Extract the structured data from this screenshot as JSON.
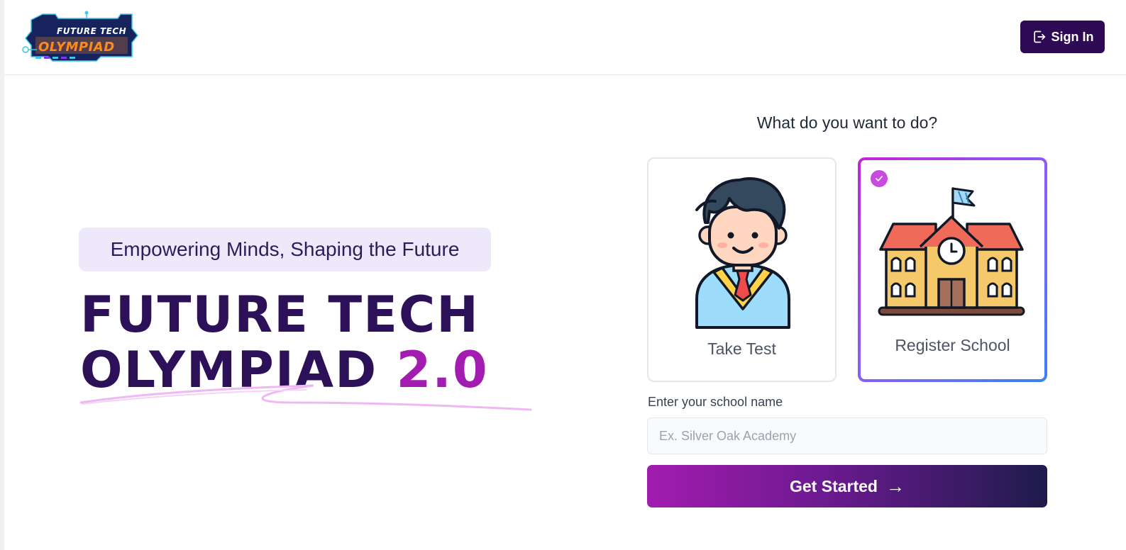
{
  "header": {
    "logo": {
      "line1": "FUTURE TECH",
      "line2": "OLYMPIAD"
    },
    "signin_label": "Sign In",
    "signin_icon": "sign-in-icon"
  },
  "hero": {
    "tagline": "Empowering Minds, Shaping the Future",
    "title_line1": "FUTURE TECH",
    "title_line2": "OLYMPIAD",
    "title_version": "2.0"
  },
  "selector": {
    "question": "What do you want to do?",
    "options": [
      {
        "label": "Take Test",
        "icon": "student-icon",
        "selected": false
      },
      {
        "label": "Register School",
        "icon": "school-building-icon",
        "selected": true
      }
    ]
  },
  "form": {
    "school_label": "Enter your school name",
    "school_placeholder": "Ex. Silver Oak Academy",
    "school_value": "",
    "submit_label": "Get Started",
    "submit_arrow": "→"
  },
  "colors": {
    "brand_dark": "#2d0a53",
    "accent_magenta": "#a21caf",
    "tagline_bg": "#ede9fb",
    "check_badge": "#c84ae0"
  }
}
